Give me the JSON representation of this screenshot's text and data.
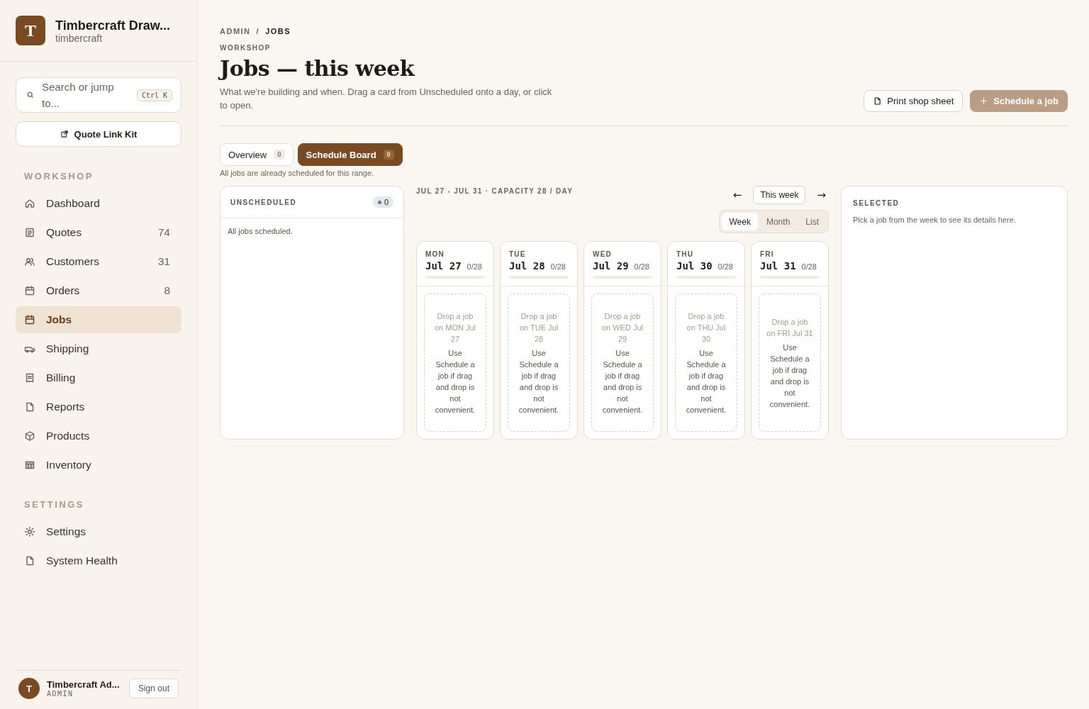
{
  "brand": {
    "logo": "T",
    "name": "Timbercraft Draw...",
    "slug": "timbercraft"
  },
  "search": {
    "placeholder": "Search or jump to...",
    "shortcut": "Ctrl K"
  },
  "quote_link": "Quote Link Kit",
  "nav_sections": [
    {
      "title": "WORKSHOP",
      "items": [
        {
          "label": "Dashboard",
          "selected": false
        },
        {
          "label": "Quotes",
          "count": "74",
          "selected": false
        },
        {
          "label": "Customers",
          "count": "31",
          "selected": false
        },
        {
          "label": "Orders",
          "count": "8",
          "selected": false
        },
        {
          "label": "Jobs",
          "selected": true
        },
        {
          "label": "Shipping",
          "selected": false
        },
        {
          "label": "Billing",
          "selected": false
        },
        {
          "label": "Reports",
          "selected": false
        },
        {
          "label": "Products",
          "selected": false
        },
        {
          "label": "Inventory",
          "selected": false
        }
      ]
    },
    {
      "title": "SETTINGS",
      "items": [
        {
          "label": "Settings",
          "selected": false
        },
        {
          "label": "System Health",
          "selected": false
        }
      ]
    }
  ],
  "user": {
    "avatar": "T",
    "name": "Timbercraft Ad...",
    "role": "ADMIN",
    "sign_out": "Sign out"
  },
  "breadcrumb": [
    "ADMIN",
    "JOBS"
  ],
  "breadcrumb_separator": "/",
  "eyebrow": "WORKSHOP",
  "title": "Jobs — this week",
  "subtitle": "What we're building and when. Drag a card from Unscheduled onto a day, or click to open.",
  "actions": [
    {
      "label": "Print shop sheet",
      "kind": "secondary"
    },
    {
      "label": "Schedule a job",
      "kind": "primary"
    }
  ],
  "tabs": [
    {
      "label": "Overview",
      "count": "0",
      "selected": false
    },
    {
      "label": "Schedule Board",
      "count": "0",
      "selected": true
    }
  ],
  "tabs_hint": "All jobs are already scheduled for this range.",
  "unscheduled": {
    "title": "UNSCHEDULED",
    "count": "0",
    "empty": "All jobs scheduled."
  },
  "week": {
    "range": "JUL 27 - JUL 31 · CAPACITY 28 / DAY",
    "prev": "←",
    "today": "This week",
    "next": "→",
    "views": [
      {
        "label": "Week",
        "selected": true
      },
      {
        "label": "Month",
        "selected": false
      },
      {
        "label": "List",
        "selected": false
      }
    ],
    "days": [
      {
        "weekday": "MON",
        "date": "Jul 27",
        "load": "0/28",
        "level": 0,
        "drop": "Drop a job on MON Jul 27",
        "hint": "Use Schedule a job if drag and drop is not convenient."
      },
      {
        "weekday": "TUE",
        "date": "Jul 28",
        "load": "0/28",
        "level": 0,
        "drop": "Drop a job on TUE Jul 28",
        "hint": "Use Schedule a job if drag and drop is not convenient."
      },
      {
        "weekday": "WED",
        "date": "Jul 29",
        "load": "0/28",
        "level": 0,
        "drop": "Drop a job on WED Jul 29",
        "hint": "Use Schedule a job if drag and drop is not convenient."
      },
      {
        "weekday": "THU",
        "date": "Jul 30",
        "load": "0/28",
        "level": 0,
        "drop": "Drop a job on THU Jul 30",
        "hint": "Use Schedule a job if drag and drop is not convenient."
      },
      {
        "weekday": "FRI",
        "date": "Jul 31",
        "load": "0/28",
        "level": 0,
        "drop": "Drop a job on FRI Jul 31",
        "hint": "Use Schedule a job if drag and drop is not convenient."
      }
    ]
  },
  "selected_panel": {
    "title": "SELECTED",
    "text": "Pick a job from the week to see its details here."
  }
}
